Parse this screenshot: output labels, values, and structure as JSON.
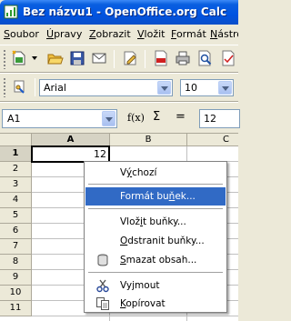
{
  "window": {
    "title": "Bez názvu1 - OpenOffice.org Calc"
  },
  "menubar": {
    "items": [
      {
        "label": "Soubor",
        "u": "S",
        "rest": "oubor"
      },
      {
        "label": "Úpravy",
        "u": "Ú",
        "rest": "pravy"
      },
      {
        "label": "Zobrazit",
        "u": "Z",
        "rest": "obrazit"
      },
      {
        "label": "Vložit",
        "u": "V",
        "rest": "ložit"
      },
      {
        "label": "Formát",
        "u": "F",
        "rest": "ormát"
      },
      {
        "label": "Nástro",
        "u": "N",
        "rest": "ástro"
      }
    ]
  },
  "toolbar": {
    "icons": [
      "new-document-icon",
      "open-folder-icon",
      "save-icon",
      "email-icon",
      "edit-file-icon",
      "export-pdf-icon",
      "print-icon",
      "page-preview-icon"
    ]
  },
  "formatting": {
    "font_name": "Arial",
    "font_size": "10"
  },
  "formula_bar": {
    "cell_ref": "A1",
    "fx_label": "f(x)",
    "sum_label": "Σ",
    "equals_label": "=",
    "content": "12"
  },
  "sheet": {
    "columns": [
      "A",
      "B",
      "C"
    ],
    "rows": [
      "1",
      "2",
      "3",
      "4",
      "5",
      "6",
      "7",
      "8",
      "9",
      "10",
      "11"
    ],
    "active_cell": "A1",
    "a1_value": "12"
  },
  "context_menu": {
    "items": [
      {
        "pre": "V",
        "u": "ý",
        "post": "chozí",
        "label": "Výchozí"
      },
      {
        "pre": "Formát bu",
        "u": "ň",
        "post": "ek...",
        "label": "Formát buněk..."
      },
      {
        "pre": "Vlož",
        "u": "i",
        "post": "t buňky...",
        "label": "Vložit buňky..."
      },
      {
        "pre": "",
        "u": "O",
        "post": "dstranit buňky...",
        "label": "Odstranit buňky..."
      },
      {
        "pre": "",
        "u": "S",
        "post": "mazat obsah...",
        "label": "Smazat obsah..."
      },
      {
        "pre": "Vy",
        "u": "j",
        "post": "mout",
        "label": "Vyjmout"
      },
      {
        "pre": "",
        "u": "K",
        "post": "opírovat",
        "label": "Kopírovat"
      }
    ],
    "highlight_color": "#316ac5"
  }
}
